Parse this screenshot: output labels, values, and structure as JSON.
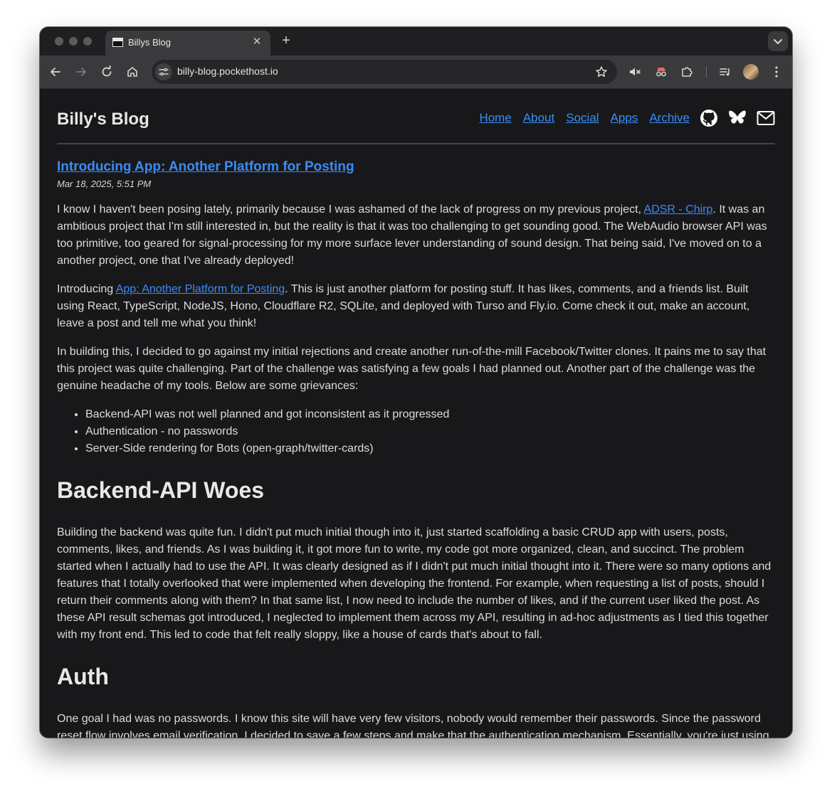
{
  "browser": {
    "tab": {
      "title": "Billys Blog"
    },
    "url": "billy-blog.pockethost.io"
  },
  "site": {
    "title": "Billy's Blog",
    "nav": [
      "Home",
      "About",
      "Social",
      "Apps",
      "Archive"
    ],
    "social_icons": [
      "github-icon",
      "bluesky-icon",
      "mail-icon"
    ],
    "accent_color": "#3b8cf5",
    "background_color": "#18181a"
  },
  "post": {
    "title": "Introducing App: Another Platform for Posting",
    "date": "Mar 18, 2025, 5:51 PM",
    "p1_a": "I know I haven't been posing lately, primarily because I was ashamed of the lack of progress on my previous project, ",
    "p1_link": "ADSR - Chirp",
    "p1_b": ". It was an ambitious project that I'm still interested in, but the reality is that it was too challenging to get sounding good. The WebAudio browser API was too primitive, too geared for signal-processing for my more surface lever understanding of sound design. That being said, I've moved on to a another project, one that I've already deployed!",
    "p2_a": "Introducing ",
    "p2_link": "App: Another Platform for Posting",
    "p2_b": ". This is just another platform for posting stuff. It has likes, comments, and a friends list. Built using React, TypeScript, NodeJS, Hono, Cloudflare R2, SQLite, and deployed with Turso and Fly.io. Come check it out, make an account, leave a post and tell me what you think!",
    "p3": "In building this, I decided to go against my initial rejections and create another run-of-the-mill Facebook/Twitter clones. It pains me to say that this project was quite challenging. Part of the challenge was satisfying a few goals I had planned out. Another part of the challenge was the genuine headache of my tools. Below are some grievances:",
    "grievances": [
      "Backend-API was not well planned and got inconsistent as it progressed",
      "Authentication - no passwords",
      "Server-Side rendering for Bots (open-graph/twitter-cards)"
    ],
    "h_backend": "Backend-API Woes",
    "p_backend": "Building the backend was quite fun. I didn't put much initial though into it, just started scaffolding a basic CRUD app with users, posts, comments, likes, and friends. As I was building it, it got more fun to write, my code got more organized, clean, and succinct. The problem started when I actually had to use the API. It was clearly designed as if I didn't put much initial thought into it. There were so many options and features that I totally overlooked that were implemented when developing the frontend. For example, when requesting a list of posts, should I return their comments along with them? In that same list, I now need to include the number of likes, and if the current user liked the post. As these API result schemas got introduced, I neglected to implement them across my API, resulting in ad-hoc adjustments as I tied this together with my front end. This led to code that felt really sloppy, like a house of cards that's about to fall.",
    "h_auth": "Auth",
    "p_auth": "One goal I had was no passwords. I know this site will have very few visitors, nobody would remember their passwords. Since the password reset flow involves email verification, I decided to save a few steps and make that the authentication mechanism. Essentially, you're just using"
  }
}
